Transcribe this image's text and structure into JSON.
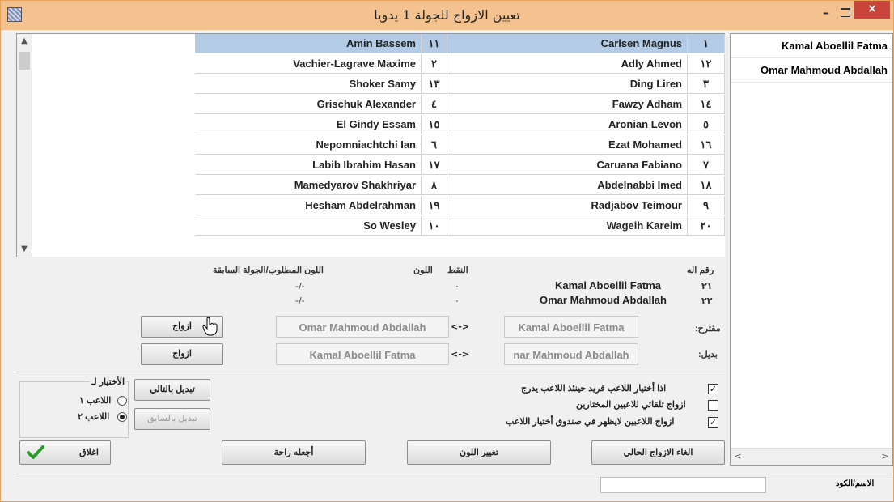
{
  "window": {
    "title": "تعيين الازواج للجولة 1 يدويا",
    "minimize_glyph": "–",
    "close_glyph": "×"
  },
  "pairings": [
    {
      "board": "١",
      "white": "Carlsen Magnus",
      "black_num": "١١",
      "black": "Amin Bassem",
      "selected": true
    },
    {
      "board": "١٢",
      "white": "Adly Ahmed",
      "black_num": "٢",
      "black": "Vachier-Lagrave Maxime"
    },
    {
      "board": "٣",
      "white": "Ding Liren",
      "black_num": "١٣",
      "black": "Shoker Samy"
    },
    {
      "board": "١٤",
      "white": "Fawzy Adham",
      "black_num": "٤",
      "black": "Grischuk Alexander"
    },
    {
      "board": "٥",
      "white": "Aronian Levon",
      "black_num": "١٥",
      "black": "El Gindy Essam"
    },
    {
      "board": "١٦",
      "white": "Ezat Mohamed",
      "black_num": "٦",
      "black": "Nepomniachtchi Ian"
    },
    {
      "board": "٧",
      "white": "Caruana Fabiano",
      "black_num": "١٧",
      "black": "Labib Ibrahim Hasan"
    },
    {
      "board": "١٨",
      "white": "Abdelnabbi Imed",
      "black_num": "٨",
      "black": "Mamedyarov Shakhriyar"
    },
    {
      "board": "٩",
      "white": "Radjabov Teimour",
      "black_num": "١٩",
      "black": "Hesham Abdelrahman"
    },
    {
      "board": "٢٠",
      "white": "Wageih Kareim",
      "black_num": "١٠",
      "black": "So Wesley"
    }
  ],
  "unpaired": [
    "Kamal Aboellil Fatma",
    "Omar Mahmoud Abdallah"
  ],
  "info": {
    "header_number": "رقم اله",
    "header_points": "النقط",
    "header_color": "اللون",
    "header_color_req": "اللون المطلوب/الجولة السابقة",
    "players": [
      {
        "num": "٢١",
        "name": "Kamal Aboellil Fatma",
        "points": "٠",
        "color": "-/-"
      },
      {
        "num": "٢٢",
        "name": "Omar Mahmoud Abdallah",
        "points": "٠",
        "color": "-/-"
      }
    ],
    "suggest_label": "مقترح:",
    "alt_label": "بديل:",
    "suggest_a": "Kamal Aboellil Fatma",
    "suggest_b": "Omar Mahmoud Abdallah",
    "alt_a": "nar Mahmoud Abdallah",
    "alt_b": "Kamal Aboellil Fatma",
    "arrow": "<->",
    "pair_button": "ازواج",
    "pair_button_2": "ازواج"
  },
  "options": {
    "opt1": "اذا أختيار اللاعب فريد حينئذ اللاعب يدرج",
    "opt1_checked": true,
    "opt2": "ازواج تلقائي للاعبين المختارين",
    "opt2_checked": false,
    "opt3": "ازواج اللاعبين لايظهر في صندوق أختيار اللاعب",
    "opt3_checked": true,
    "group_title": "الأختيار لـ",
    "radio1": "اللاعب ١",
    "radio2": "اللاعب ٢",
    "radio_selected": 2,
    "swap_next": "تبديل بالتالي",
    "swap_prev": "تبديل بالسابق"
  },
  "buttons": {
    "cancel_pairing": "الغاء الازواج الحالي",
    "change_color": "تغيير اللون",
    "give_bye": "أجعله راحة",
    "close": "اغلاق"
  },
  "status": {
    "label": "الاسم/الكود"
  },
  "colors": {
    "titlebar": "#f4c28f",
    "selected_row": "#b4cbe6",
    "close_button": "#c7453a",
    "check_green": "#2f9b2f"
  }
}
